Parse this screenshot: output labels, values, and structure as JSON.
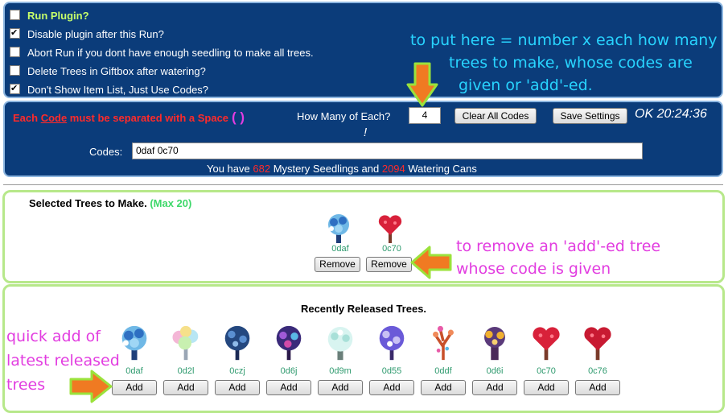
{
  "options": [
    {
      "label": "Run Plugin?",
      "checked": false,
      "highlight": true
    },
    {
      "label": "Disable plugin after this Run?",
      "checked": true
    },
    {
      "label": "Abort Run if you dont have enough seedling to make all trees.",
      "checked": false
    },
    {
      "label": "Delete Trees in Giftbox after watering?",
      "checked": false
    },
    {
      "label": "Don't Show Item List, Just Use Codes?",
      "checked": true
    }
  ],
  "annotations": {
    "top_line1": "to put here = number x each how many",
    "top_line2": "trees to make, whose codes are",
    "top_line3": "given or 'add'-ed.",
    "remove_line1": "to remove an 'add'-ed tree",
    "remove_line2": "whose code is given",
    "quick_line1": "quick add of",
    "quick_line2": "latest released",
    "quick_line3": "trees"
  },
  "codes_panel": {
    "sep_each": "Each ",
    "sep_code": "Code",
    "sep_rest": " must be separated with a Space",
    "sep_paren": "( )",
    "how_many_label": "How Many of Each?",
    "how_many_value": "4",
    "clear_button": "Clear All Codes",
    "save_button": "Save Settings",
    "status": "OK 20:24:36",
    "status_excl": "!",
    "codes_label": "Codes:",
    "codes_value": "0daf 0c70",
    "you_have": "You have",
    "seedlings_count": "682",
    "seedlings_text": "Mystery Seedlings and",
    "cans_count": "2094",
    "cans_text": "Watering Cans"
  },
  "selected": {
    "title": "Selected Trees to Make.",
    "max": "(Max 20)",
    "remove_label": "Remove",
    "trees": [
      {
        "code": "0daf",
        "icon": "blue-tree-icon"
      },
      {
        "code": "0c70",
        "icon": "heart-tree-icon"
      }
    ]
  },
  "recent": {
    "title": "Recently Released Trees.",
    "add_label": "Add",
    "trees": [
      {
        "code": "0daf",
        "icon": "blue-tree-icon"
      },
      {
        "code": "0d2l",
        "icon": "rainbow-tree-icon"
      },
      {
        "code": "0czj",
        "icon": "navy-tree-icon"
      },
      {
        "code": "0d6j",
        "icon": "purple-tree-icon"
      },
      {
        "code": "0d9m",
        "icon": "frost-tree-icon"
      },
      {
        "code": "0d55",
        "icon": "violet-tree-icon"
      },
      {
        "code": "0ddf",
        "icon": "coral-tree-icon"
      },
      {
        "code": "0d6i",
        "icon": "amber-tree-icon"
      },
      {
        "code": "0c70",
        "icon": "heart-tree-icon"
      },
      {
        "code": "0c76",
        "icon": "heart-tree-icon"
      }
    ]
  },
  "colors": {
    "panel": "#0b3c7a",
    "annotation_cyan": "#28d4ff",
    "annotation_magenta": "#e23de0",
    "arrow_orange": "#f07a22",
    "arrow_outline": "#9be23b",
    "count_red": "#ff2a2a",
    "code_green": "#2e9a6e"
  }
}
